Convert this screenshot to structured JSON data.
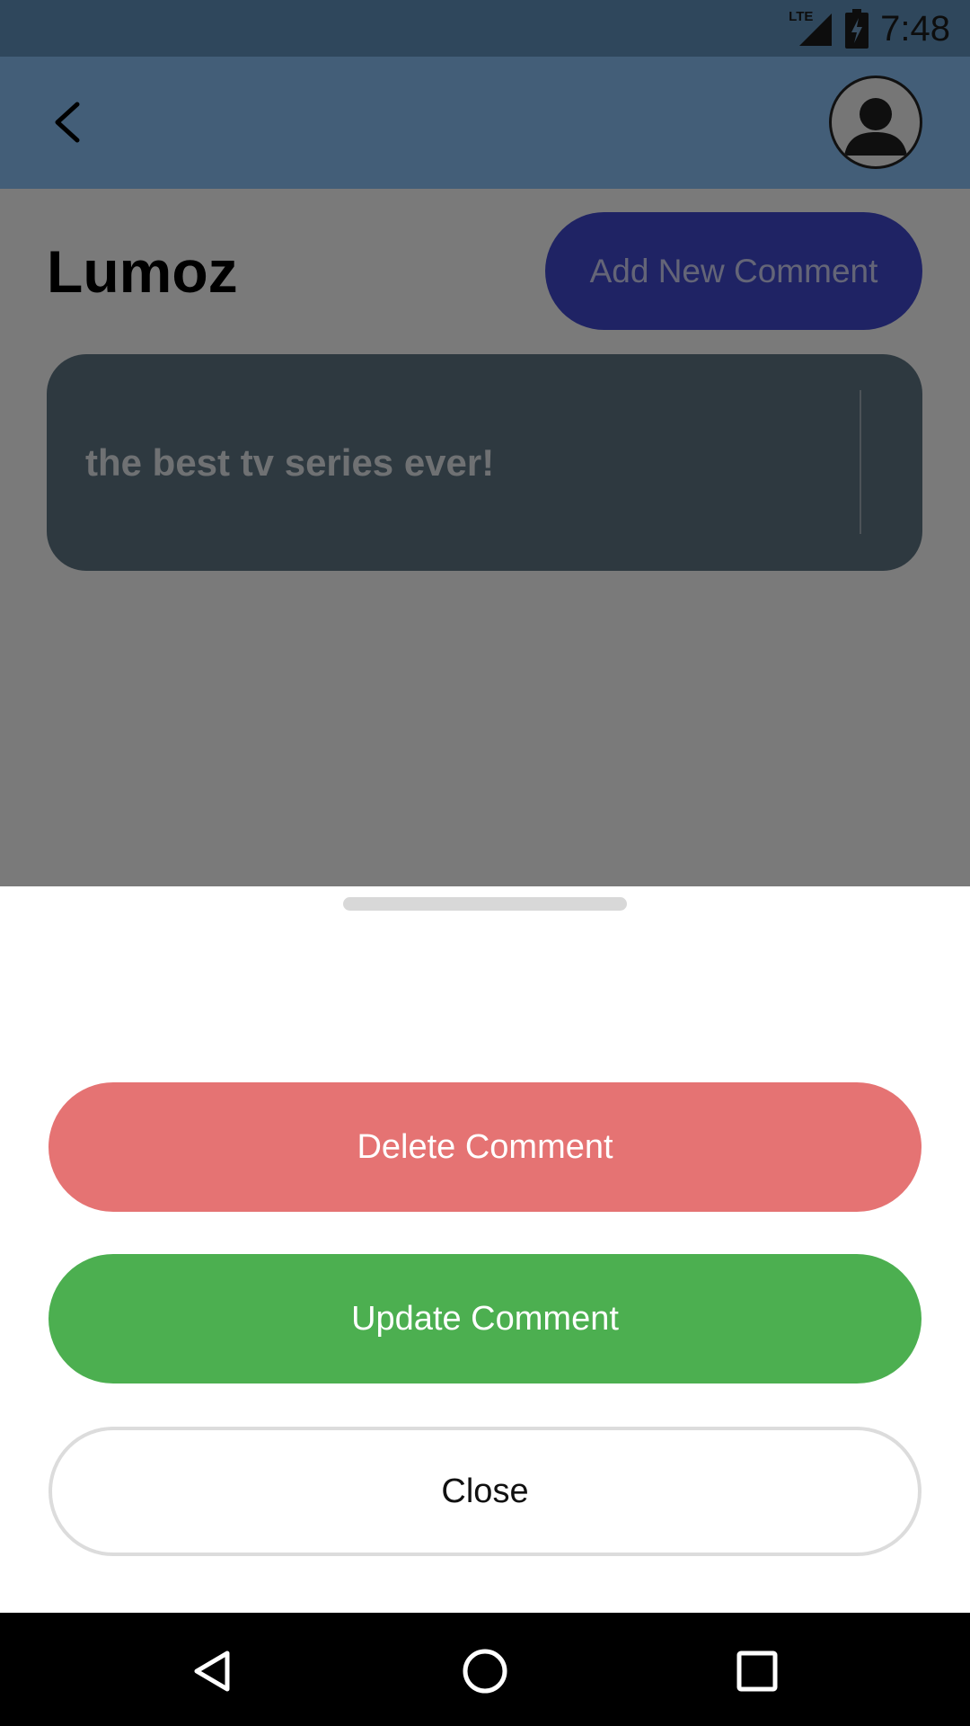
{
  "status_bar": {
    "time": "7:48",
    "network_label": "LTE",
    "icons": [
      "lte-signal-icon",
      "battery-charging-icon"
    ]
  },
  "app_bar": {
    "back_icon": "back-arrow-icon",
    "avatar_icon": "user-avatar-icon"
  },
  "page": {
    "title": "Lumoz",
    "add_comment_label": "Add New Comment"
  },
  "comments": [
    {
      "text": "the best tv series ever!"
    }
  ],
  "sheet": {
    "delete_label": "Delete Comment",
    "update_label": "Update Comment",
    "close_label": "Close"
  },
  "nav_bar": {
    "icons": [
      "nav-back-icon",
      "nav-home-icon",
      "nav-recents-icon"
    ]
  },
  "colors": {
    "app_bar": "#86bcf0",
    "add_button": "#3f47c9",
    "comment_card": "#5c7280",
    "delete_button": "#e57373",
    "update_button": "#4caf50"
  }
}
